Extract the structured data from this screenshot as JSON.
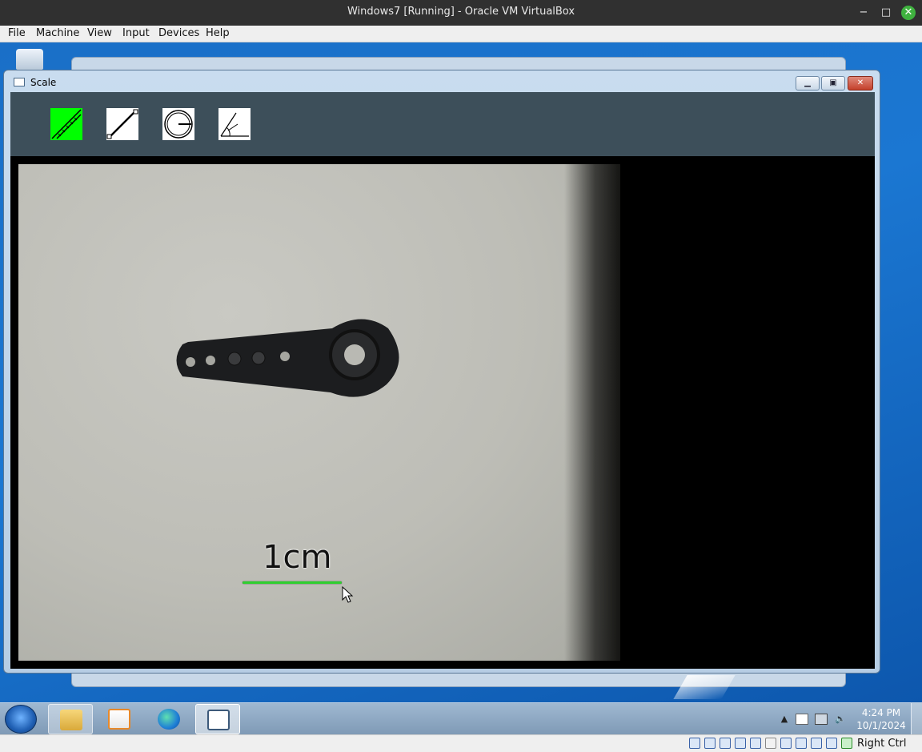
{
  "host": {
    "title": "Windows7 [Running] - Oracle VM VirtualBox",
    "menu": [
      "File",
      "Machine",
      "View",
      "Input",
      "Devices",
      "Help"
    ],
    "controls": {
      "minimize": "−",
      "maximize": "□",
      "close": "✕"
    }
  },
  "scale_app": {
    "title": "Scale",
    "tools": [
      {
        "name": "ruler-icon",
        "active": true
      },
      {
        "name": "line-icon",
        "active": false
      },
      {
        "name": "circle-icon",
        "active": false
      },
      {
        "name": "angle-icon",
        "active": false
      }
    ],
    "measurement_label": "1cm",
    "line_color": "#2fcf2f"
  },
  "taskbar": {
    "time": "4:24 PM",
    "date": "10/1/2024"
  },
  "vbox_status": {
    "host_key": "Right Ctrl"
  }
}
